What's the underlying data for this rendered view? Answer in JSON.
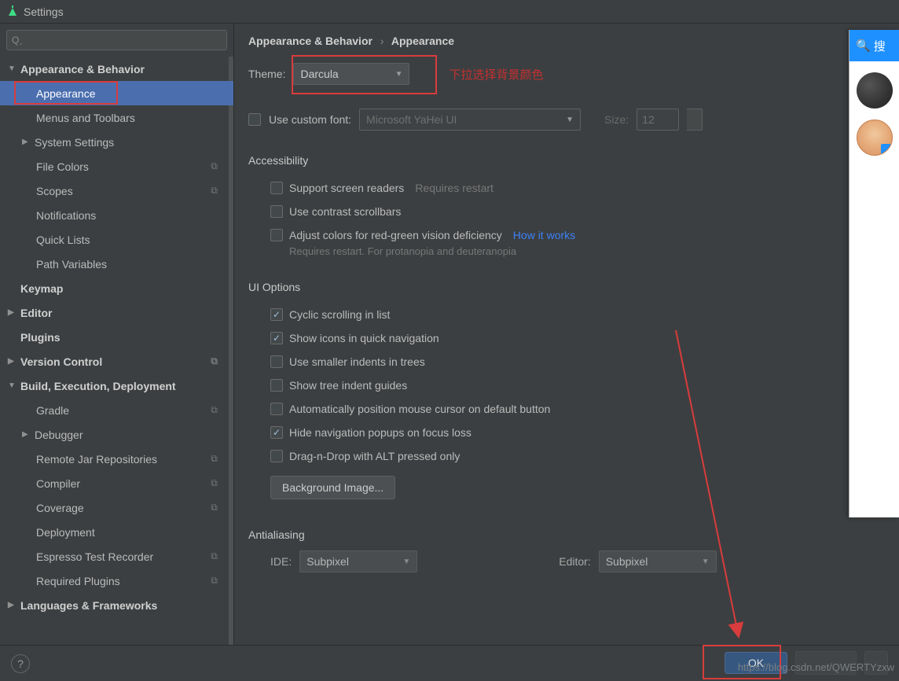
{
  "window": {
    "title": "Settings"
  },
  "search": {
    "placeholder": ""
  },
  "tree": [
    {
      "label": "Appearance & Behavior",
      "bold": true,
      "chev": "▼",
      "indent": 0
    },
    {
      "label": "Appearance",
      "indent": 2,
      "selected": true,
      "redbox": true
    },
    {
      "label": "Menus and Toolbars",
      "indent": 2
    },
    {
      "label": "System Settings",
      "indent": 1,
      "chev": "▶"
    },
    {
      "label": "File Colors",
      "indent": 2,
      "copy": true
    },
    {
      "label": "Scopes",
      "indent": 2,
      "copy": true
    },
    {
      "label": "Notifications",
      "indent": 2
    },
    {
      "label": "Quick Lists",
      "indent": 2
    },
    {
      "label": "Path Variables",
      "indent": 2
    },
    {
      "label": "Keymap",
      "bold": true,
      "indent": 0,
      "noarrow": true
    },
    {
      "label": "Editor",
      "bold": true,
      "chev": "▶",
      "indent": 0,
      "outdent": true
    },
    {
      "label": "Plugins",
      "bold": true,
      "indent": 0,
      "noarrow": true
    },
    {
      "label": "Version Control",
      "bold": true,
      "chev": "▶",
      "indent": 0,
      "outdent": true,
      "copy": true
    },
    {
      "label": "Build, Execution, Deployment",
      "bold": true,
      "chev": "▼",
      "indent": 0
    },
    {
      "label": "Gradle",
      "indent": 2,
      "copy": true
    },
    {
      "label": "Debugger",
      "indent": 1,
      "chev": "▶"
    },
    {
      "label": "Remote Jar Repositories",
      "indent": 2,
      "copy": true
    },
    {
      "label": "Compiler",
      "indent": 2,
      "copy": true
    },
    {
      "label": "Coverage",
      "indent": 2,
      "copy": true
    },
    {
      "label": "Deployment",
      "indent": 2
    },
    {
      "label": "Espresso Test Recorder",
      "indent": 2,
      "copy": true
    },
    {
      "label": "Required Plugins",
      "indent": 2,
      "copy": true
    },
    {
      "label": "Languages & Frameworks",
      "bold": true,
      "chev": "▶",
      "indent": 0,
      "outdent": true
    }
  ],
  "breadcrumb": {
    "root": "Appearance & Behavior",
    "leaf": "Appearance"
  },
  "theme": {
    "label": "Theme:",
    "value": "Darcula"
  },
  "note": "下拉选择背景颜色",
  "customFont": {
    "label": "Use custom font:",
    "font": "Microsoft YaHei UI",
    "sizeLabel": "Size:",
    "size": "12"
  },
  "accessibility": {
    "title": "Accessibility",
    "screenReaders": "Support screen readers",
    "restart": "Requires restart",
    "contrast": "Use contrast scrollbars",
    "adjust": "Adjust colors for red-green vision deficiency",
    "how": "How it works",
    "sub": "Requires restart. For protanopia and deuteranopia"
  },
  "ui": {
    "title": "UI Options",
    "cyclic": "Cyclic scrolling in list",
    "icons": "Show icons in quick navigation",
    "smaller": "Use smaller indents in trees",
    "guides": "Show tree indent guides",
    "cursor": "Automatically position mouse cursor on default button",
    "hide": "Hide navigation popups on focus loss",
    "dnd": "Drag-n-Drop with ALT pressed only",
    "bg": "Background Image..."
  },
  "aa": {
    "title": "Antialiasing",
    "ideLabel": "IDE:",
    "ide": "Subpixel",
    "editorLabel": "Editor:",
    "editor": "Subpixel"
  },
  "footer": {
    "ok": "OK",
    "url": "https://blog.csdn.net/QWERTYzxw"
  },
  "strip": {
    "search": "搜"
  }
}
